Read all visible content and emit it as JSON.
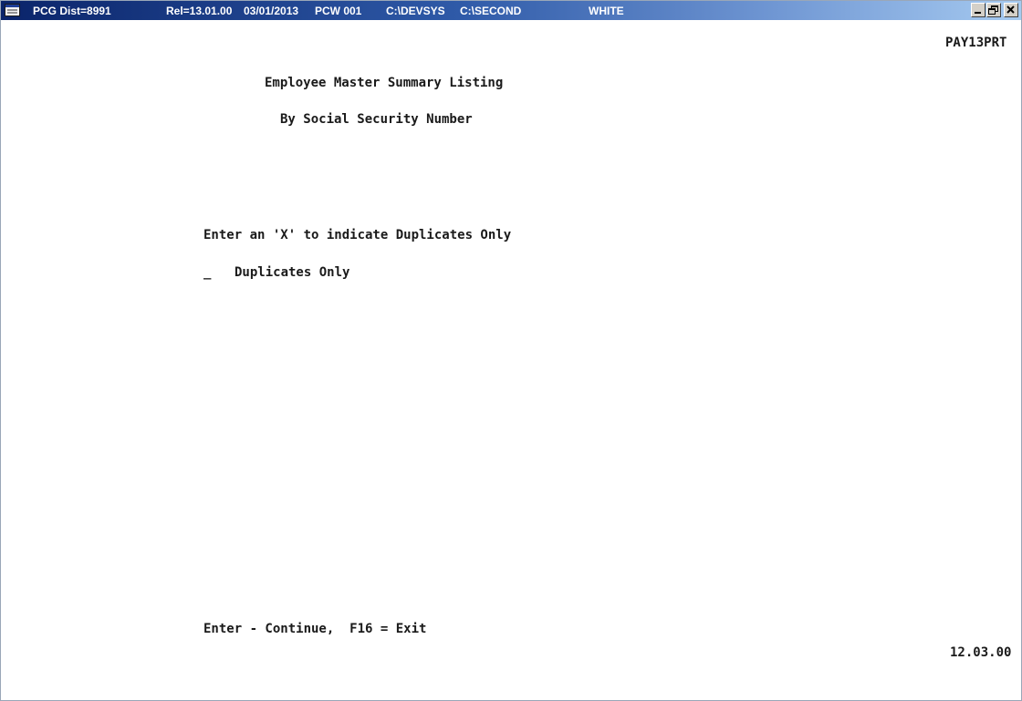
{
  "titlebar": {
    "system": "PCG Dist=8991",
    "release": "Rel=13.01.00",
    "date": "03/01/2013",
    "workstation": "PCW 001",
    "path1": "C:\\DEVSYS",
    "path2": "C:\\SECOND",
    "theme": "WHITE",
    "icon": "menu-icon",
    "controls": [
      "minimize-icon",
      "restore-icon",
      "close-icon"
    ]
  },
  "screen": {
    "program_id": "PAY13PRT",
    "title": "Employee Master Summary Listing",
    "subtitle": "By Social Security Number",
    "instruction": "Enter an 'X' to indicate Duplicates Only",
    "duplicates_field_value": "_",
    "duplicates_label": "Duplicates Only",
    "footer_keys": "Enter - Continue,  F16 = Exit",
    "version": "12.03.00"
  },
  "colors": {
    "titlebar_dark": "#0a246a",
    "titlebar_light": "#a6caf0",
    "screen_bg": "#ffffff",
    "text": "#1a1a1a"
  }
}
